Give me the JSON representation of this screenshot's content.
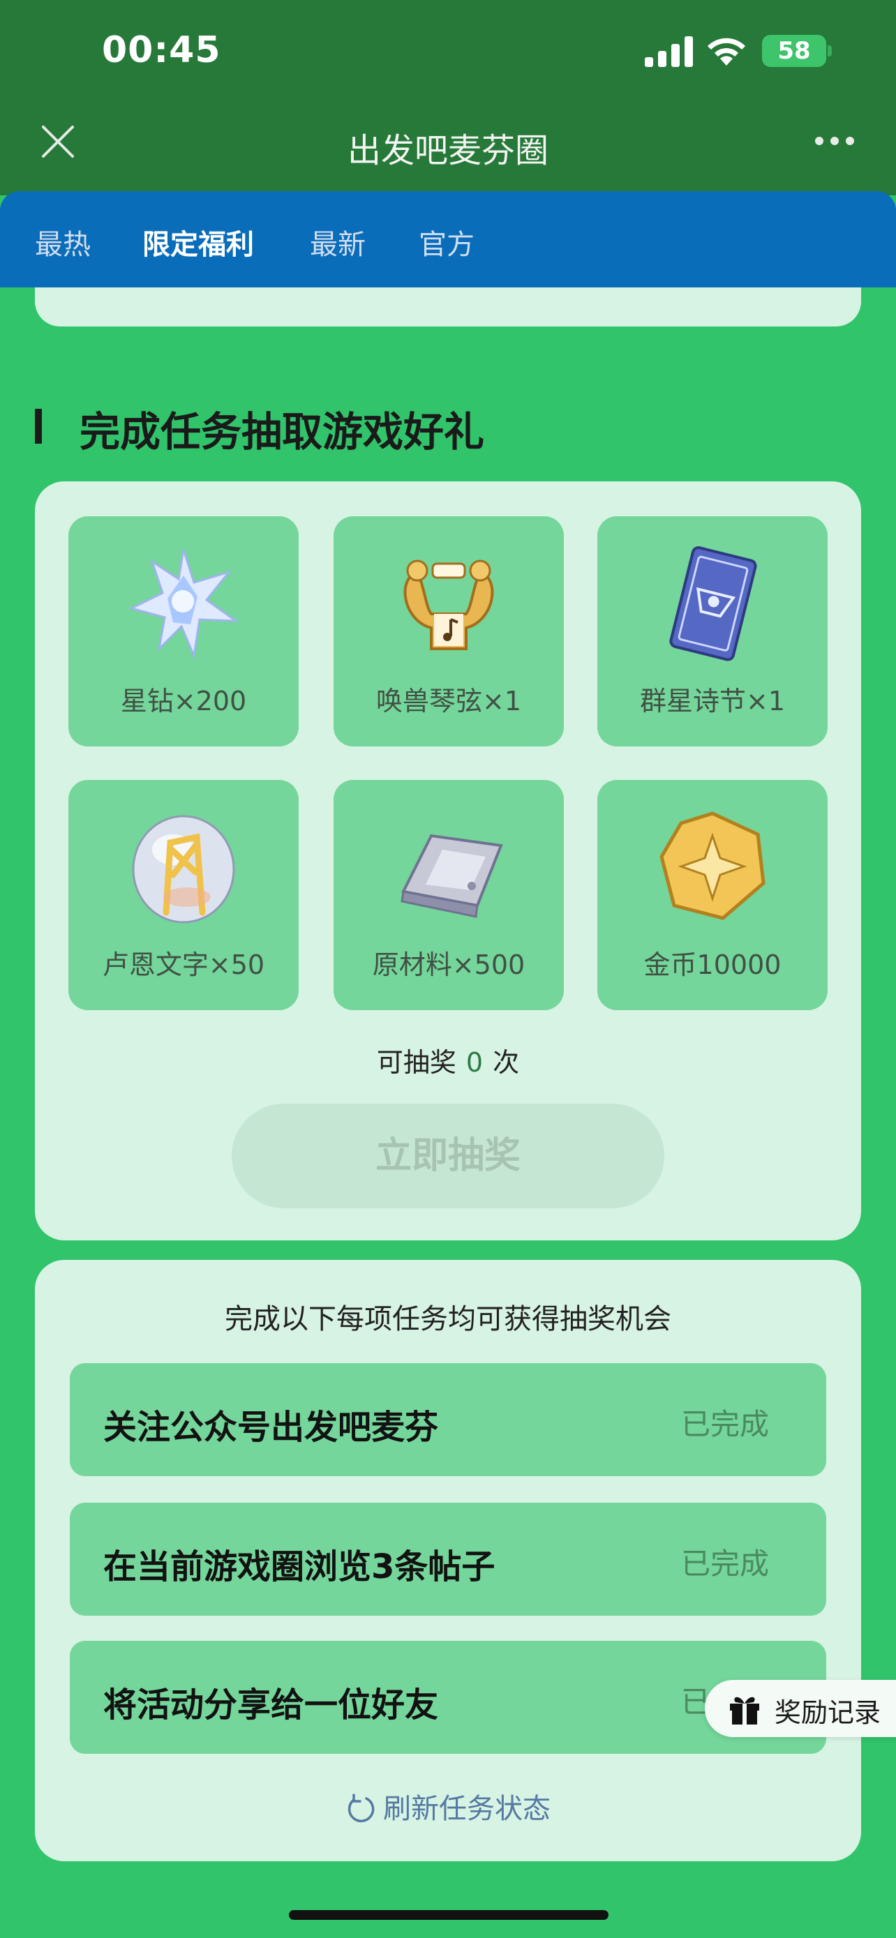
{
  "status_bar": {
    "time": "00:45",
    "battery": "58"
  },
  "header": {
    "title": "出发吧麦芬圈"
  },
  "tabs": [
    {
      "label": "最热"
    },
    {
      "label": "限定福利",
      "active": true
    },
    {
      "label": "最新"
    },
    {
      "label": "官方"
    }
  ],
  "section": {
    "title": "完成任务抽取游戏好礼"
  },
  "prizes": [
    {
      "label": "星钻×200",
      "icon": "star-diamond-icon"
    },
    {
      "label": "唤兽琴弦×1",
      "icon": "lyre-icon"
    },
    {
      "label": "群星诗节×1",
      "icon": "star-card-icon"
    },
    {
      "label": "卢恩文字×50",
      "icon": "rune-orb-icon"
    },
    {
      "label": "原材料×500",
      "icon": "ingot-icon"
    },
    {
      "label": "金币10000",
      "icon": "gold-coin-icon"
    }
  ],
  "draw": {
    "prefix": "可抽奖",
    "count": "0",
    "suffix": "次",
    "button_label": "立即抽奖"
  },
  "tasks": {
    "heading": "完成以下每项任务均可获得抽奖机会",
    "items": [
      {
        "name": "关注公众号出发吧麦芬",
        "status": "已完成"
      },
      {
        "name": "在当前游戏圈浏览3条帖子",
        "status": "已完成"
      },
      {
        "name": "将活动分享给一位好友",
        "status": "已完成"
      }
    ],
    "refresh_label": "刷新任务状态"
  },
  "floating": {
    "reward_label": "奖励记录"
  },
  "colors": {
    "page_bg": "#31C46B",
    "header_bg": "#267938",
    "tab_bg": "#0A6DBA",
    "card_bg": "#D7F3E3",
    "tile_bg": "#74D69A"
  }
}
